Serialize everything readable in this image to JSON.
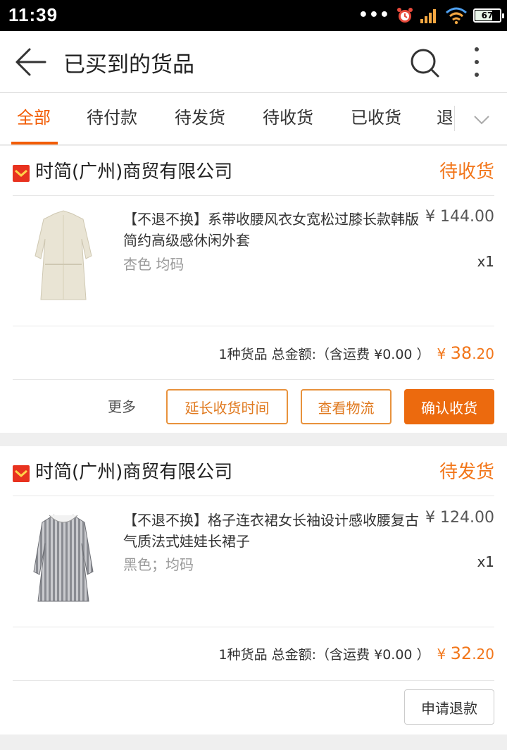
{
  "status_bar": {
    "time": "11:39",
    "battery": "67",
    "dots": "•••"
  },
  "header": {
    "title": "已买到的货品"
  },
  "tabs": [
    {
      "label": "全部"
    },
    {
      "label": "待付款"
    },
    {
      "label": "待发货"
    },
    {
      "label": "待收货"
    },
    {
      "label": "已收货"
    },
    {
      "label": "退"
    }
  ],
  "orders": [
    {
      "store": "时简(广州)商贸有限公司",
      "status": "待收货",
      "product": {
        "title": "【不退不换】系带收腰风衣女宽松过膝长款韩版简约高级感休闲外套",
        "price": "¥ 144.00",
        "spec": "杏色 均码",
        "qty": "x1"
      },
      "summary": {
        "text": "1种货品 总金额:（含运费 ¥0.00 ）",
        "currency": "¥ ",
        "amount_int": "38",
        "amount_dec": ".20"
      },
      "actions": {
        "more": "更多",
        "extend": "延长收货时间",
        "logistics": "查看物流",
        "confirm": "确认收货"
      }
    },
    {
      "store": "时简(广州)商贸有限公司",
      "status": "待发货",
      "product": {
        "title": "【不退不换】格子连衣裙女长袖设计感收腰复古气质法式娃娃长裙子",
        "price": "¥ 124.00",
        "spec": "黑色；均码",
        "qty": "x1"
      },
      "summary": {
        "text": "1种货品 总金额:（含运费 ¥0.00 ）",
        "currency": "¥ ",
        "amount_int": "32",
        "amount_dec": ".20"
      },
      "actions": {
        "refund": "申请退款"
      }
    }
  ],
  "colors": {
    "accent": "#f25c05",
    "status": "#f2761a",
    "button": "#ec6a0e"
  }
}
